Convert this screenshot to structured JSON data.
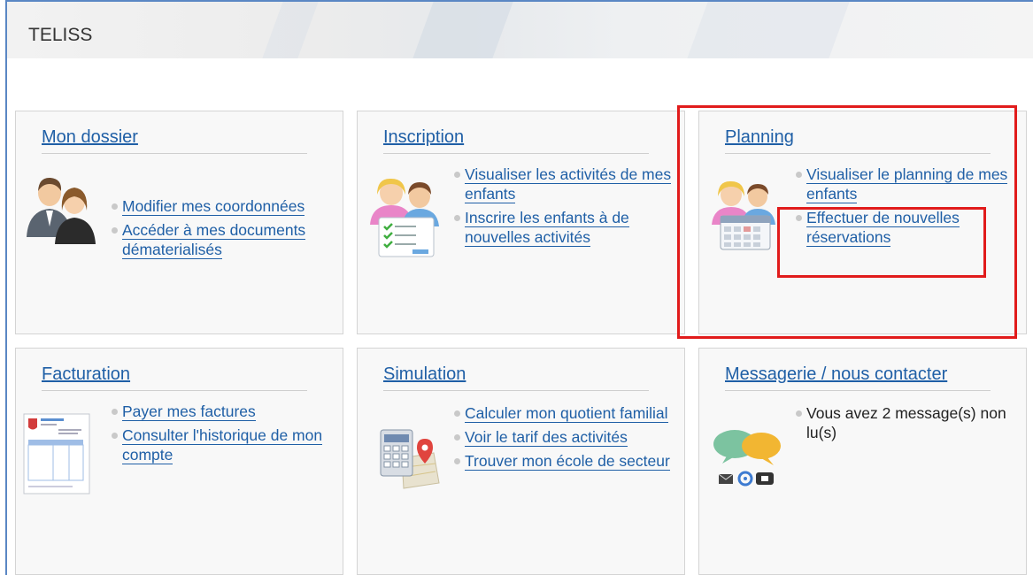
{
  "app": {
    "title": "TELISS"
  },
  "cards": {
    "dossier": {
      "title": "Mon dossier",
      "links": [
        "Modifier mes coordonnées",
        "Accéder à mes documents dématerialisés"
      ]
    },
    "inscription": {
      "title": "Inscription",
      "links": [
        "Visualiser les activités de mes enfants",
        "Inscrire les enfants à de nouvelles activités"
      ]
    },
    "planning": {
      "title": "Planning",
      "links": [
        "Visualiser le planning de mes enfants",
        "Effectuer de nouvelles réservations"
      ]
    },
    "facturation": {
      "title": "Facturation",
      "links": [
        "Payer mes factures",
        "Consulter l'historique de mon compte"
      ]
    },
    "simulation": {
      "title": "Simulation",
      "links": [
        "Calculer mon quotient familial",
        "Voir le tarif des activités",
        "Trouver mon école de secteur"
      ]
    },
    "messagerie": {
      "title": "Messagerie / nous contacter",
      "message": "Vous avez 2 message(s) non lu(s)"
    }
  },
  "colors": {
    "link": "#1f5fa6",
    "highlight": "#e11b1b"
  },
  "icons": [
    "parents-icon",
    "children-checklist-icon",
    "children-calendar-icon",
    "invoice-icon",
    "calculator-map-icon",
    "chat-bubbles-icon"
  ]
}
